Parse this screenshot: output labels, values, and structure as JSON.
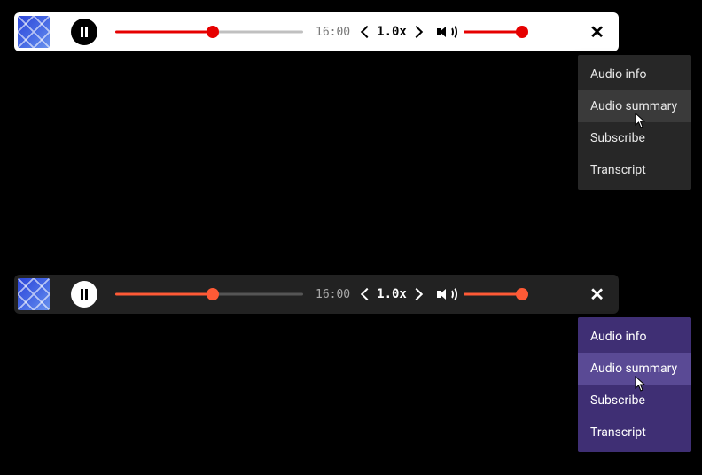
{
  "player": {
    "duration_label": "16:00",
    "speed_label": "1.0x",
    "progress_percent": 52,
    "volume_percent": 92
  },
  "menu": {
    "items": [
      {
        "label": "Audio info"
      },
      {
        "label": "Audio summary"
      },
      {
        "label": "Subscribe"
      },
      {
        "label": "Transcript"
      }
    ],
    "hover_index": 1
  },
  "colors": {
    "light_accent": "#e60000",
    "dark_accent": "#ff5a36"
  }
}
